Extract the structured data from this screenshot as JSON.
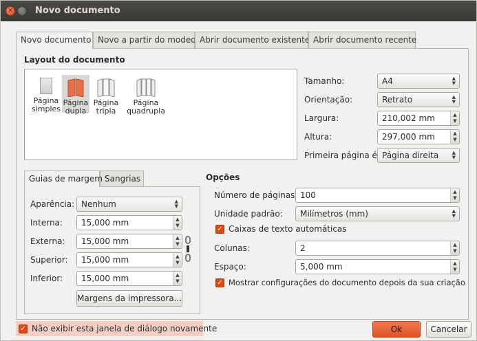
{
  "window": {
    "title": "Novo documento"
  },
  "tabs": [
    {
      "label": "Novo documento"
    },
    {
      "label": "Novo a partir do modeo"
    },
    {
      "label": "Abrir documento existente"
    },
    {
      "label": "Abrir documento recente"
    }
  ],
  "layout": {
    "title": "Layout do documento",
    "options": [
      {
        "label1": "Página",
        "label2": "simples",
        "icon": "single-page-icon"
      },
      {
        "label1": "Página",
        "label2": "dupla",
        "icon": "double-page-icon",
        "selected": true
      },
      {
        "label1": "Página",
        "label2": "tripla",
        "icon": "triple-page-icon"
      },
      {
        "label1": "Página",
        "label2": "quadrupla",
        "icon": "quadruple-page-icon"
      }
    ],
    "size_label": "Tamanho:",
    "size_value": "A4",
    "orientation_label": "Orientação:",
    "orientation_value": "Retrato",
    "width_label": "Largura:",
    "width_value": "210,002 mm",
    "height_label": "Altura:",
    "height_value": "297,000 mm",
    "first_page_label": "Primeira página é:",
    "first_page_value": "Página direita"
  },
  "margins": {
    "tabs": [
      {
        "label": "Guias de margem"
      },
      {
        "label": "Sangrias"
      }
    ],
    "appearance_label": "Aparência:",
    "appearance_value": "Nenhum",
    "inner_label": "Interna:",
    "inner_value": "15,000 mm",
    "outer_label": "Externa:",
    "outer_value": "15,000 mm",
    "top_label": "Superior:",
    "top_value": "15,000 mm",
    "bottom_label": "Inferior:",
    "bottom_value": "15,000 mm",
    "printer_margins_button": "Margens da impressora..."
  },
  "options": {
    "title": "Opções",
    "pages_label": "Número de páginas:",
    "pages_value": "100",
    "unit_label": "Unidade padrão:",
    "unit_value": "Milímetros (mm)",
    "auto_text_frames_label": "Caixas de texto automáticas",
    "columns_label": "Colunas:",
    "columns_value": "2",
    "gap_label": "Espaço:",
    "gap_value": "5,000 mm",
    "show_settings_label": "Mostrar configurações do documento depois da sua criação"
  },
  "footer": {
    "dont_show_label": "Não exibir esta janela de diálogo novamente",
    "ok_label": "Ok",
    "cancel_label": "Cancelar"
  },
  "colors": {
    "accent": "#dd4814",
    "titlebar": "#3c3b37",
    "highlight": "#f5cfc3"
  }
}
